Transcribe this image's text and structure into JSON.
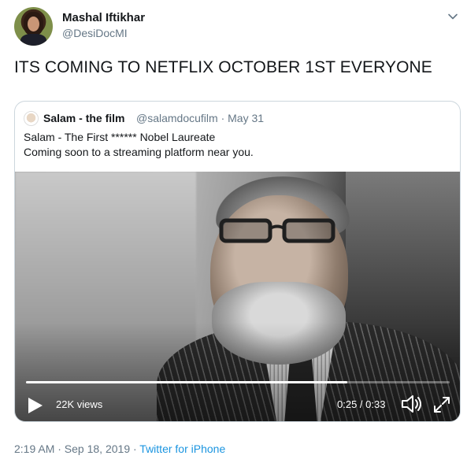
{
  "author": {
    "display_name": "Mashal Iftikhar",
    "handle": "@DesiDocMI"
  },
  "tweet": {
    "text": "ITS COMING TO NETFLIX OCTOBER 1ST EVERYONE"
  },
  "quoted_tweet": {
    "display_name": "Salam - the film",
    "handle_and_date": "@salamdocufilm · May 31",
    "line1": "Salam - The First ****** Nobel Laureate",
    "line2": "Coming soon to a streaming platform near you."
  },
  "video": {
    "views": "22K views",
    "time": "0:25 / 0:33",
    "progress_fraction": 0.758
  },
  "footer": {
    "timestamp": "2:19 AM · Sep 18, 2019 · ",
    "source": "Twitter for iPhone"
  },
  "colors": {
    "link": "#1b95e0",
    "secondary_text": "#657786",
    "primary_text": "#14171a"
  },
  "icons": [
    "chevron-down-icon",
    "play-icon",
    "volume-icon",
    "fullscreen-icon"
  ]
}
